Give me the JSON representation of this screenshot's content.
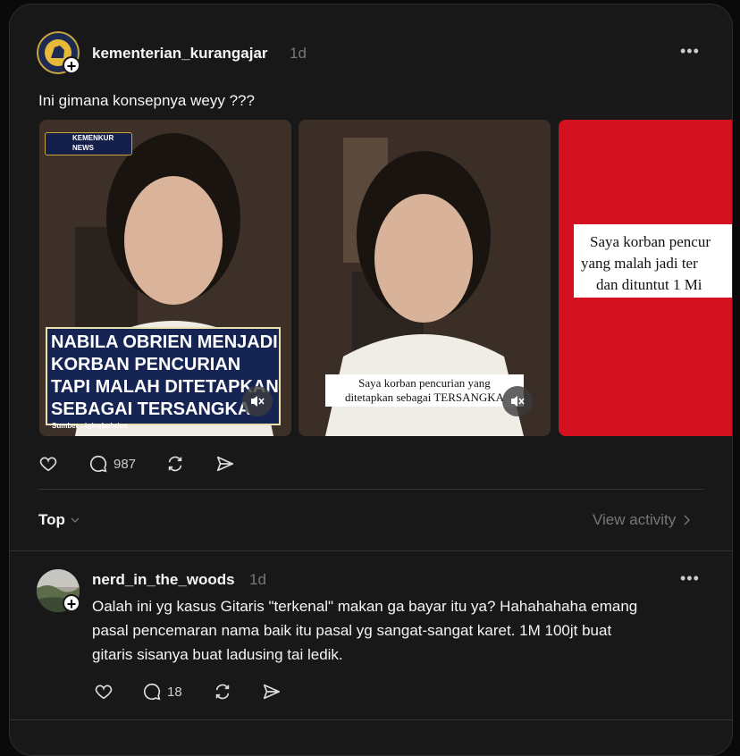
{
  "post": {
    "username": "kementerian_kurangajar",
    "time": "1d",
    "text": "Ini gimana konsepnya weyy ???",
    "media": [
      {
        "badge": "KEMENKUR NEWS",
        "headline_lines": [
          "NABILA OBRIEN MENJADI",
          "KORBAN PENCURIAN",
          "TAPI MALAH DITETAPKAN",
          "SEBAGAI TERSANGKA"
        ],
        "source": "Sumber : ig/nabobrien"
      },
      {
        "caption_lines": [
          "Saya korban pencurian yang",
          "ditetapkan sebagai TERSANGKA"
        ]
      },
      {
        "caption_lines": [
          "Saya korban pencur",
          "yang malah jadi ter",
          "dan dituntut 1 Mi"
        ]
      }
    ],
    "reply_count": "987"
  },
  "filter": {
    "sort_label": "Top",
    "view_activity_label": "View activity"
  },
  "reply": {
    "username": "nerd_in_the_woods",
    "time": "1d",
    "lines": [
      "Oalah ini yg kasus Gitaris \"terkenal\" makan ga bayar itu ya? Hahahahaha emang",
      "pasal pencemaran nama baik itu pasal yg sangat-sangat karet. 1M 100jt buat",
      "gitaris sisanya buat ladusing tai ledik."
    ],
    "reply_count": "18"
  }
}
